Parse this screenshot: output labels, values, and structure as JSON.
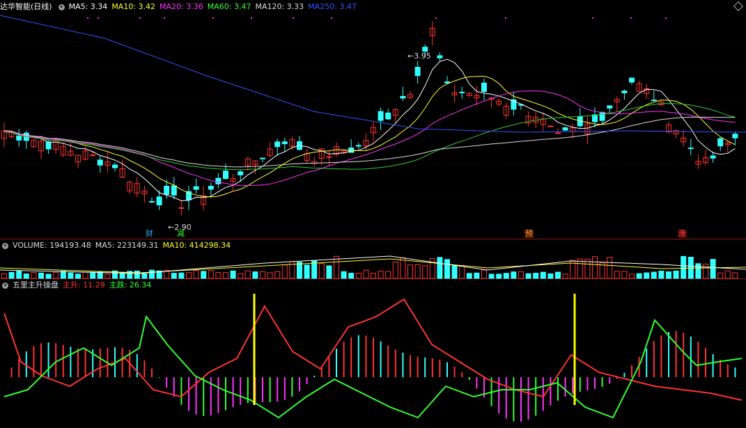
{
  "main_header": {
    "title": "达华智能(日线)",
    "ma": [
      {
        "label": "MA5: 3.34",
        "color": "#ffffff"
      },
      {
        "label": "MA10: 3.42",
        "color": "#ffff33"
      },
      {
        "label": "MA20: 3.36",
        "color": "#ff33ff"
      },
      {
        "label": "MA60: 3.47",
        "color": "#33ff33"
      },
      {
        "label": "MA120: 3.33",
        "color": "#dddddd"
      },
      {
        "label": "MA250: 3.47",
        "color": "#3355ff"
      }
    ]
  },
  "price_annotations": {
    "high": "3.95",
    "low": "2.90"
  },
  "event_tags": [
    "财",
    "减",
    "预",
    "涨"
  ],
  "volume_header": {
    "label": "VOLUME: 194193.48",
    "ma5": "MA5: 223149.31",
    "ma10": "MA10: 414298.34"
  },
  "indicator_header": {
    "name": "五里主升操盘",
    "up": "主升: 11.29",
    "down": "主跌: 26.34"
  },
  "colors": {
    "up": "#ff3333",
    "down": "#33ffff",
    "ma250": "#3355ff",
    "ma60": "#33cc33",
    "ma20": "#ff33ff",
    "ma10": "#ffff33",
    "ma5": "#ffffff",
    "ma120": "#dddddd",
    "green_line": "#33ff33",
    "magenta": "#ff33ff",
    "yellow": "#ffff00"
  }
}
